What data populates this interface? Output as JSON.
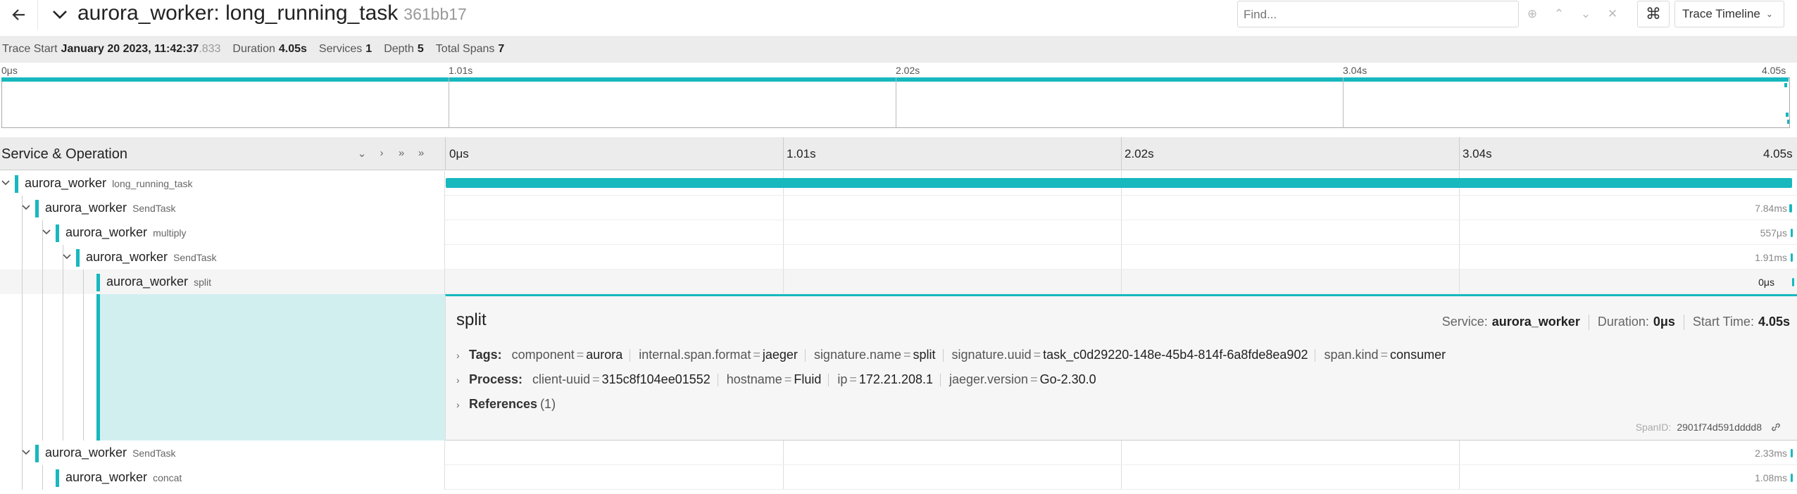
{
  "header": {
    "title": "aurora_worker: long_running_task",
    "trace_id_short": "361bb17",
    "find_placeholder": "Find...",
    "view_select": "Trace Timeline"
  },
  "summary": {
    "trace_start_label": "Trace Start",
    "trace_start_value": "January 20 2023, 11:42:37",
    "trace_start_ms": ".833",
    "duration_label": "Duration",
    "duration_value": "4.05s",
    "services_label": "Services",
    "services_value": "1",
    "depth_label": "Depth",
    "depth_value": "5",
    "total_spans_label": "Total Spans",
    "total_spans_value": "7"
  },
  "minimap": {
    "ticks": [
      "0μs",
      "1.01s",
      "2.02s",
      "3.04s",
      "4.05s"
    ]
  },
  "timeline_header": {
    "title": "Service & Operation",
    "ticks": [
      "0μs",
      "1.01s",
      "2.02s",
      "3.04s",
      "4.05s"
    ]
  },
  "spans": [
    {
      "service": "aurora_worker",
      "operation": "long_running_task",
      "depth": 0,
      "expanded": true,
      "duration": "",
      "start_frac": 0.0,
      "width_frac": 1.0
    },
    {
      "service": "aurora_worker",
      "operation": "SendTask",
      "depth": 1,
      "expanded": true,
      "duration": "7.84ms",
      "start_frac": 0.998,
      "width_frac": 0.002
    },
    {
      "service": "aurora_worker",
      "operation": "multiply",
      "depth": 2,
      "expanded": true,
      "duration": "557μs",
      "start_frac": 0.999,
      "width_frac": 0.001
    },
    {
      "service": "aurora_worker",
      "operation": "SendTask",
      "depth": 3,
      "expanded": true,
      "duration": "1.91ms",
      "start_frac": 0.999,
      "width_frac": 0.001
    },
    {
      "service": "aurora_worker",
      "operation": "split",
      "depth": 4,
      "expanded": false,
      "duration": "0μs",
      "start_frac": 1.0,
      "width_frac": 0.0
    },
    {
      "service": "aurora_worker",
      "operation": "SendTask",
      "depth": 1,
      "expanded": true,
      "duration": "2.33ms",
      "start_frac": 0.999,
      "width_frac": 0.001
    },
    {
      "service": "aurora_worker",
      "operation": "concat",
      "depth": 2,
      "expanded": false,
      "duration": "1.08ms",
      "start_frac": 0.999,
      "width_frac": 0.001
    }
  ],
  "detail": {
    "title": "split",
    "service_label": "Service:",
    "service_value": "aurora_worker",
    "duration_label": "Duration:",
    "duration_value": "0μs",
    "start_label": "Start Time:",
    "start_value": "4.05s",
    "tags_label": "Tags:",
    "tags": [
      {
        "k": "component",
        "v": "aurora"
      },
      {
        "k": "internal.span.format",
        "v": "jaeger"
      },
      {
        "k": "signature.name",
        "v": "split"
      },
      {
        "k": "signature.uuid",
        "v": "task_c0d29220-148e-45b4-814f-6a8fde8ea902"
      },
      {
        "k": "span.kind",
        "v": "consumer"
      }
    ],
    "process_label": "Process:",
    "process": [
      {
        "k": "client-uuid",
        "v": "315c8f104ee01552"
      },
      {
        "k": "hostname",
        "v": "Fluid"
      },
      {
        "k": "ip",
        "v": "172.21.208.1"
      },
      {
        "k": "jaeger.version",
        "v": "Go-2.30.0"
      }
    ],
    "references_label": "References",
    "references_count": "(1)",
    "spanid_label": "SpanID:",
    "spanid_value": "2901f74d591dddd8"
  },
  "colors": {
    "accent": "#17b8be",
    "detail_fill": "#d2eff0"
  },
  "icons": {
    "back": "arrow-left-icon",
    "collapse": "chevron-down-icon",
    "target": "target-icon",
    "up": "chevron-up-icon",
    "down": "chevron-down-icon",
    "close": "close-icon",
    "keyboard": "command-icon",
    "link": "link-icon"
  }
}
